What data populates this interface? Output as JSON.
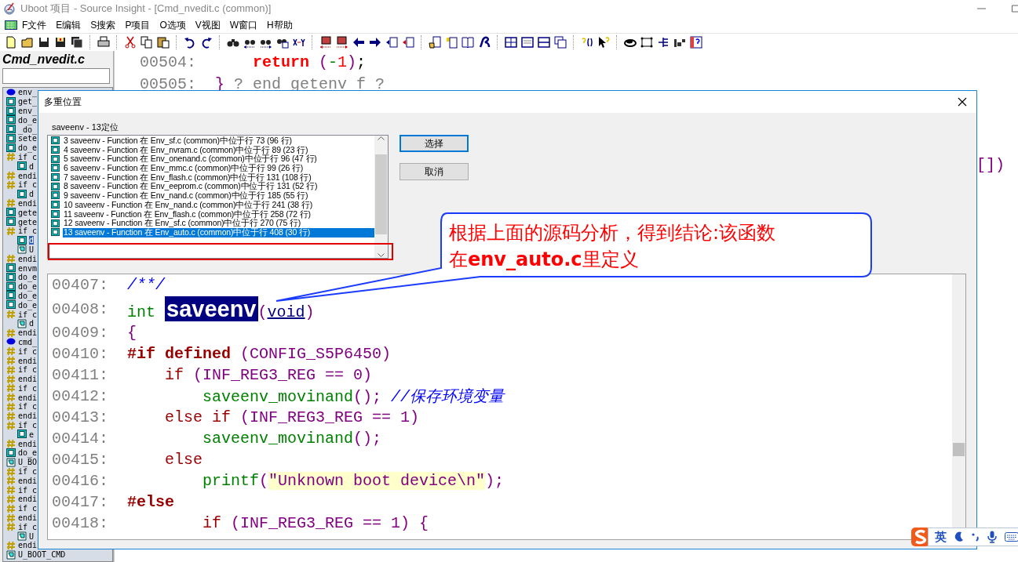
{
  "window": {
    "title": "Uboot 项目 - Source Insight - [Cmd_nvedit.c (common)]"
  },
  "menu": [
    {
      "label": "F文件"
    },
    {
      "label": "E编辑"
    },
    {
      "label": "S搜索"
    },
    {
      "label": "P项目"
    },
    {
      "label": "O选项"
    },
    {
      "label": "V视图"
    },
    {
      "label": "W窗口"
    },
    {
      "label": "H帮助"
    }
  ],
  "sidebar": {
    "title": "Cmd_nvedit.c",
    "items": [
      {
        "kind": "variable",
        "label": "env_",
        "selected": false
      },
      {
        "kind": "function",
        "label": "get_",
        "selected": false
      },
      {
        "kind": "function",
        "label": "env_",
        "selected": false
      },
      {
        "kind": "function",
        "label": "do_e",
        "selected": false
      },
      {
        "kind": "function",
        "label": "_do_",
        "selected": false
      },
      {
        "kind": "function",
        "label": "sete",
        "selected": false
      },
      {
        "kind": "function",
        "label": "do_e",
        "selected": false
      },
      {
        "kind": "macro",
        "label": "if c",
        "selected": false,
        "children": [
          {
            "kind": "function",
            "label": "d",
            "selected": false
          }
        ]
      },
      {
        "kind": "macro",
        "label": "endi",
        "selected": false
      },
      {
        "kind": "macro",
        "label": "if c",
        "selected": false,
        "children": [
          {
            "kind": "function",
            "label": "d",
            "selected": false
          }
        ]
      },
      {
        "kind": "macro",
        "label": "endi",
        "selected": false
      },
      {
        "kind": "function",
        "label": "gete",
        "selected": false
      },
      {
        "kind": "function",
        "label": "gete",
        "selected": false
      },
      {
        "kind": "macro",
        "label": "if c",
        "selected": false,
        "children": [
          {
            "kind": "function",
            "label": "d",
            "selected": true
          },
          {
            "kind": "declaration",
            "label": "U",
            "selected": false
          }
        ]
      },
      {
        "kind": "macro",
        "label": "endi",
        "selected": false
      },
      {
        "kind": "function",
        "label": "envm",
        "selected": false
      },
      {
        "kind": "function",
        "label": "do_e",
        "selected": false
      },
      {
        "kind": "function",
        "label": "do_e",
        "selected": false
      },
      {
        "kind": "function",
        "label": "do_e",
        "selected": false
      },
      {
        "kind": "function",
        "label": "do_e",
        "selected": false
      },
      {
        "kind": "macro",
        "label": "if c",
        "selected": false,
        "children": [
          {
            "kind": "declaration",
            "label": "d",
            "selected": false
          }
        ]
      },
      {
        "kind": "macro",
        "label": "endi",
        "selected": false
      },
      {
        "kind": "variable",
        "label": "cmd_",
        "selected": false
      },
      {
        "kind": "macro",
        "label": "if c",
        "selected": false
      },
      {
        "kind": "macro",
        "label": "endi",
        "selected": false
      },
      {
        "kind": "macro",
        "label": "if c",
        "selected": false
      },
      {
        "kind": "macro",
        "label": "endi",
        "selected": false
      },
      {
        "kind": "macro",
        "label": "if c",
        "selected": false
      },
      {
        "kind": "macro",
        "label": "endi",
        "selected": false
      },
      {
        "kind": "macro",
        "label": "if c",
        "selected": false
      },
      {
        "kind": "macro",
        "label": "endi",
        "selected": false
      },
      {
        "kind": "macro",
        "label": "if c",
        "selected": false,
        "children": [
          {
            "kind": "function",
            "label": "e",
            "selected": false
          }
        ]
      },
      {
        "kind": "macro",
        "label": "endi",
        "selected": false
      },
      {
        "kind": "function",
        "label": "do_e",
        "selected": false
      },
      {
        "kind": "declaration",
        "label": "U_BO",
        "selected": false
      },
      {
        "kind": "macro",
        "label": "if c",
        "selected": false
      },
      {
        "kind": "macro",
        "label": "endi",
        "selected": false
      },
      {
        "kind": "macro",
        "label": "if c",
        "selected": false
      },
      {
        "kind": "macro",
        "label": "endi",
        "selected": false
      },
      {
        "kind": "macro",
        "label": "if c",
        "selected": false
      },
      {
        "kind": "macro",
        "label": "endi",
        "selected": false
      },
      {
        "kind": "macro",
        "label": "if c",
        "selected": false,
        "children": [
          {
            "kind": "declaration",
            "label": "U",
            "selected": false
          }
        ]
      },
      {
        "kind": "macro",
        "label": "endi",
        "selected": false
      },
      {
        "kind": "declaration",
        "label": "U_BOOT_CMD",
        "selected": false
      }
    ]
  },
  "editor": {
    "lines": [
      {
        "number": "00504:",
        "tokens": [
          {
            "kind": "return",
            "text": "    return "
          },
          {
            "kind": "punct",
            "text": "("
          },
          {
            "kind": "func",
            "text": "-"
          },
          {
            "kind": "number",
            "text": "1"
          },
          {
            "kind": "punct",
            "text": ")"
          },
          {
            "kind": "plain",
            "text": ";"
          }
        ]
      },
      {
        "number": "00505:",
        "tokens": [
          {
            "kind": "punct",
            "text": "} "
          },
          {
            "kind": "gray",
            "text": "? end getenv f ?"
          }
        ]
      }
    ],
    "fragment": "[])"
  },
  "dialog": {
    "title": "多重位置",
    "heading": "saveenv - 13定位",
    "items": [
      {
        "text": "3 saveenv - Function 在 Env_sf.c (common)中位于行 73 (96 行)",
        "selected": false
      },
      {
        "text": "4 saveenv - Function 在 Env_nvram.c (common)中位于行 89 (23 行)",
        "selected": false
      },
      {
        "text": "5 saveenv - Function 在 Env_onenand.c (common)中位于行 96 (47 行)",
        "selected": false
      },
      {
        "text": "6 saveenv - Function 在 Env_mmc.c (common)中位于行 99 (26 行)",
        "selected": false
      },
      {
        "text": "7 saveenv - Function 在 Env_flash.c (common)中位于行 131 (108 行)",
        "selected": false
      },
      {
        "text": "8 saveenv - Function 在 Env_eeprom.c (common)中位于行 131 (52 行)",
        "selected": false
      },
      {
        "text": "9 saveenv - Function 在 Env_nand.c (common)中位于行 185 (55 行)",
        "selected": false
      },
      {
        "text": "10 saveenv - Function 在 Env_nand.c (common)中位于行 241 (38 行)",
        "selected": false
      },
      {
        "text": "11 saveenv - Function 在 Env_flash.c (common)中位于行 258 (72 行)",
        "selected": false
      },
      {
        "text": "12 saveenv - Function 在 Env_sf.c (common)中位于行 270 (75 行)",
        "selected": false
      },
      {
        "text": "13 saveenv - Function 在 Env_auto.c (common)中位于行 408 (30 行)",
        "selected": true
      }
    ],
    "buttons": [
      {
        "label": "选择",
        "default": true
      },
      {
        "label": "取消",
        "default": false
      }
    ],
    "preview": [
      {
        "number": "00407:",
        "tokens": [
          {
            "kind": "comment",
            "text": "/**/"
          }
        ]
      },
      {
        "number": "00408:",
        "tokens": [
          {
            "kind": "type",
            "text": "int "
          },
          {
            "kind": "symbol",
            "text": "saveenv"
          },
          {
            "kind": "punct",
            "text": "("
          },
          {
            "kind": "param",
            "text": "void"
          },
          {
            "kind": "punct",
            "text": ")"
          }
        ]
      },
      {
        "number": "00409:",
        "tokens": [
          {
            "kind": "punct",
            "text": "{"
          }
        ]
      },
      {
        "number": "00410:",
        "tokens": [
          {
            "kind": "preproc",
            "text": "#if defined "
          },
          {
            "kind": "punct",
            "text": "(CONFIG_S5P6450)"
          }
        ]
      },
      {
        "number": "00411:",
        "tokens": [
          {
            "kind": "keyword",
            "text": "    if "
          },
          {
            "kind": "punct",
            "text": "(INF_REG3_REG == 0)"
          }
        ]
      },
      {
        "number": "00412:",
        "tokens": [
          {
            "kind": "func",
            "text": "        saveenv_movinand"
          },
          {
            "kind": "punct",
            "text": "(); "
          },
          {
            "kind": "comment",
            "text": "//保存环境变量"
          }
        ]
      },
      {
        "number": "00413:",
        "tokens": [
          {
            "kind": "keyword",
            "text": "    else if "
          },
          {
            "kind": "punct",
            "text": "(INF_REG3_REG == 1)"
          }
        ]
      },
      {
        "number": "00414:",
        "tokens": [
          {
            "kind": "func",
            "text": "        saveenv_movinand"
          },
          {
            "kind": "punct",
            "text": "();"
          }
        ]
      },
      {
        "number": "00415:",
        "tokens": [
          {
            "kind": "keyword",
            "text": "    else"
          }
        ]
      },
      {
        "number": "00416:",
        "tokens": [
          {
            "kind": "func",
            "text": "        printf"
          },
          {
            "kind": "punct",
            "text": "("
          },
          {
            "kind": "string",
            "text": "\"Unknown boot device\\n\""
          },
          {
            "kind": "punct",
            "text": ");"
          }
        ]
      },
      {
        "number": "00417:",
        "tokens": [
          {
            "kind": "preproc",
            "text": "#else"
          }
        ]
      },
      {
        "number": "00418:",
        "tokens": [
          {
            "kind": "keyword",
            "text": "        if "
          },
          {
            "kind": "punct",
            "text": "(INF_REG3_REG == 1) {"
          }
        ]
      }
    ]
  },
  "callout": {
    "lines": [
      "根据上面的源码分析，得到结论:该函数",
      "在**env_auto.c**里定义"
    ]
  },
  "ime": {
    "mode": "英"
  }
}
